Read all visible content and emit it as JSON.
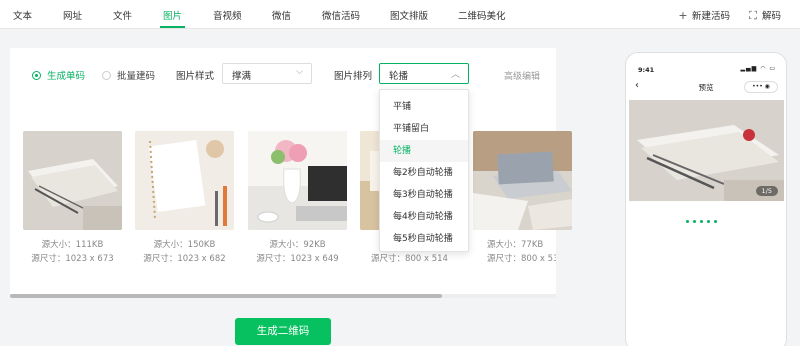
{
  "topnav": {
    "tabs": [
      "文本",
      "网址",
      "文件",
      "图片",
      "音视频",
      "微信",
      "微信活码",
      "图文排版",
      "二维码美化"
    ],
    "active_tab": "图片",
    "new_code": "新建活码",
    "decode": "解码"
  },
  "form": {
    "mode_single": "生成单码",
    "mode_batch": "批量建码",
    "selected_mode": "生成单码",
    "style_label": "图片样式",
    "style_value": "撑满",
    "arrange_label": "图片排列",
    "arrange_value": "轮播",
    "advanced": "高级编辑"
  },
  "images": [
    {
      "size": "源大小：111KB",
      "dims": "源尺寸：1023 x 673"
    },
    {
      "size": "源大小：150KB",
      "dims": "源尺寸：1023 x 682"
    },
    {
      "size": "源大小：92KB",
      "dims": "源尺寸：1023 x 649"
    },
    {
      "size": "源大小：",
      "dims": "源尺寸：800 x 514"
    },
    {
      "size": "源大小：77KB",
      "dims": "源尺寸：800 x 533"
    }
  ],
  "dropdown": {
    "options": [
      "平铺",
      "平铺留白",
      "轮播",
      "每2秒自动轮播",
      "每3秒自动轮播",
      "每4秒自动轮播",
      "每5秒自动轮播"
    ],
    "selected": "轮播"
  },
  "generate_button": "生成二维码",
  "phone": {
    "time": "9:41",
    "title": "预览",
    "capsule": "••• ◉",
    "counter": "1/5",
    "dots_count": 5
  },
  "colors": {
    "accent": "#07b262",
    "button": "#07c160"
  }
}
